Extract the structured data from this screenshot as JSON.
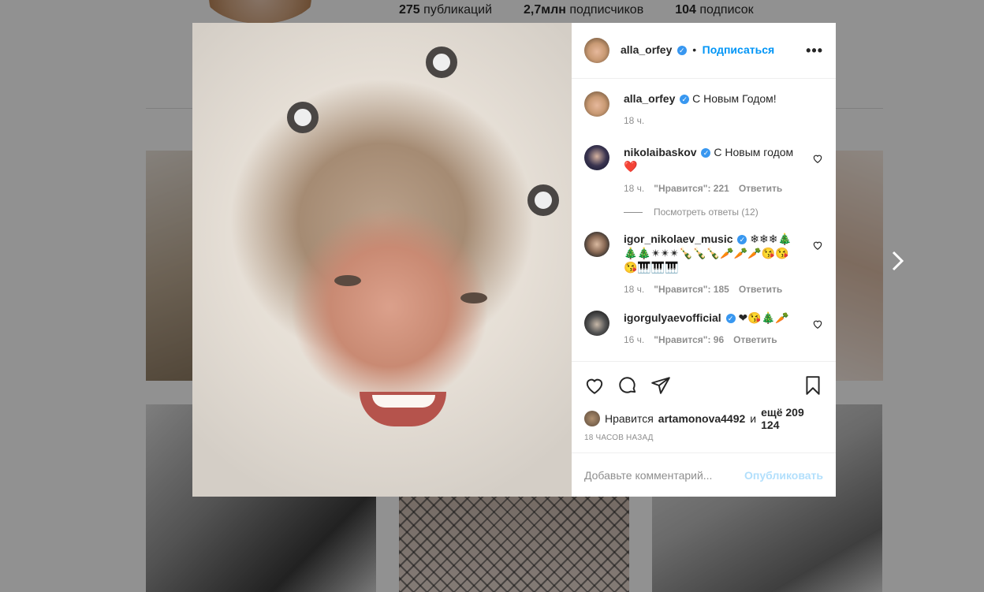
{
  "profile": {
    "posts": "275",
    "posts_label": "публикаций",
    "followers": "2,7млн",
    "followers_label": "подписчиков",
    "following": "104",
    "following_label": "подписок"
  },
  "post": {
    "author": "alla_orfey",
    "follow_label": "Подписаться",
    "dot": "•",
    "more_icon": "more-horizontal-icon",
    "caption": "С Новым Годом!",
    "caption_time": "18 ч.",
    "likes_prefix": "Нравится",
    "likes_user": "artamonova4492",
    "likes_and": "и",
    "likes_rest": "ещё 209 124",
    "time_ago": "18 ЧАСОВ НАЗАД",
    "comment_placeholder": "Добавьте комментарий...",
    "publish_label": "Опубликовать"
  },
  "comments": [
    {
      "user": "nikolaibaskov",
      "text": "С Новым годом",
      "emoji": "❤️",
      "time": "18 ч.",
      "likes": "\"Нравится\": 221",
      "reply": "Ответить"
    },
    {
      "user": "igor_nikolaev_music",
      "text": "❄❄❄🎄🎄🎄✴✴✴🍾🍾🍾🥕🥕🥕😘😘😘🎹🎹🎹",
      "time": "18 ч.",
      "likes": "\"Нравится\": 185",
      "reply": "Ответить"
    },
    {
      "user": "igorgulyaevofficial",
      "text": "❤😘🎄🥕",
      "time": "16 ч.",
      "likes": "\"Нравится\": 96",
      "reply": "Ответить"
    }
  ],
  "view_replies": "Посмотреть ответы (12)",
  "colors": {
    "accent": "#0095f6",
    "verified": "#3897f0",
    "heart": "#ed4956"
  }
}
